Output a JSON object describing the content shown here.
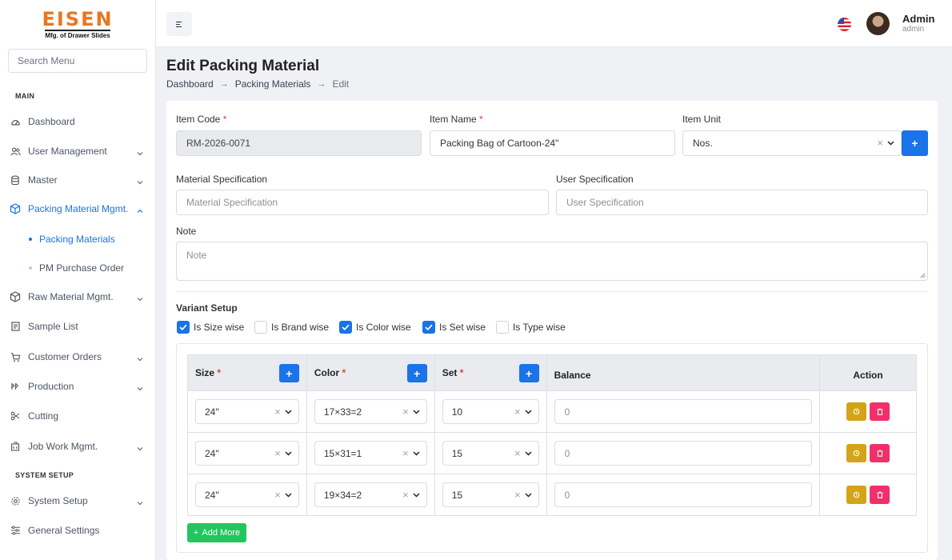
{
  "brand": {
    "logo_text": "EISEN",
    "tagline": "Mfg. of Drawer Slides"
  },
  "sidebar": {
    "search_placeholder": "Search Menu",
    "sections": {
      "main": "MAIN",
      "system": "SYSTEM SETUP"
    },
    "items": [
      {
        "label": "Dashboard",
        "icon": "dashboard-icon"
      },
      {
        "label": "User Management",
        "icon": "users-icon"
      },
      {
        "label": "Master",
        "icon": "database-icon"
      },
      {
        "label": "Packing Material Mgmt.",
        "icon": "box-icon"
      },
      {
        "label": "Raw Material Mgmt.",
        "icon": "box-icon"
      },
      {
        "label": "Sample List",
        "icon": "list-icon"
      },
      {
        "label": "Customer Orders",
        "icon": "cart-icon"
      },
      {
        "label": "Production",
        "icon": "production-icon"
      },
      {
        "label": "Cutting",
        "icon": "scissors-icon"
      },
      {
        "label": "Job Work Mgmt.",
        "icon": "building-icon"
      },
      {
        "label": "System Setup",
        "icon": "gear-icon"
      },
      {
        "label": "General Settings",
        "icon": "sliders-icon"
      }
    ],
    "sub_items": [
      "Packing Materials",
      "PM Purchase Order"
    ]
  },
  "topbar": {
    "user_name": "Admin",
    "user_role": "admin"
  },
  "page": {
    "title": "Edit Packing Material",
    "breadcrumb": [
      "Dashboard",
      "Packing Materials",
      "Edit"
    ]
  },
  "form": {
    "item_code_label": "Item Code",
    "item_code_value": "RM-2026-0071",
    "item_name_label": "Item Name",
    "item_name_value": "Packing Bag of Cartoon-24\"",
    "item_unit_label": "Item Unit",
    "item_unit_value": "Nos.",
    "material_spec_label": "Material Specification",
    "material_spec_placeholder": "Material Specification",
    "user_spec_label": "User Specification",
    "user_spec_placeholder": "User Specification",
    "note_label": "Note",
    "note_placeholder": "Note",
    "required_mark": "*"
  },
  "variant": {
    "title": "Variant Setup",
    "options": [
      {
        "label": "Is Size wise",
        "checked": true
      },
      {
        "label": "Is Brand wise",
        "checked": false
      },
      {
        "label": "Is Color wise",
        "checked": true
      },
      {
        "label": "Is Set wise",
        "checked": true
      },
      {
        "label": "Is Type wise",
        "checked": false
      }
    ],
    "headers": {
      "size": "Size",
      "color": "Color",
      "set": "Set",
      "balance": "Balance",
      "action": "Action"
    },
    "rows": [
      {
        "size": "24\"",
        "color": "17×33=2",
        "set": "10",
        "balance": "0"
      },
      {
        "size": "24\"",
        "color": "15×31=1",
        "set": "15",
        "balance": "0"
      },
      {
        "size": "24\"",
        "color": "19×34=2",
        "set": "15",
        "balance": "0"
      }
    ],
    "add_more": "Add More"
  },
  "colors": {
    "primary": "#1a73e8",
    "success": "#22c55e",
    "warning": "#d4a418",
    "danger": "#f0306a",
    "brand": "#e87722"
  }
}
